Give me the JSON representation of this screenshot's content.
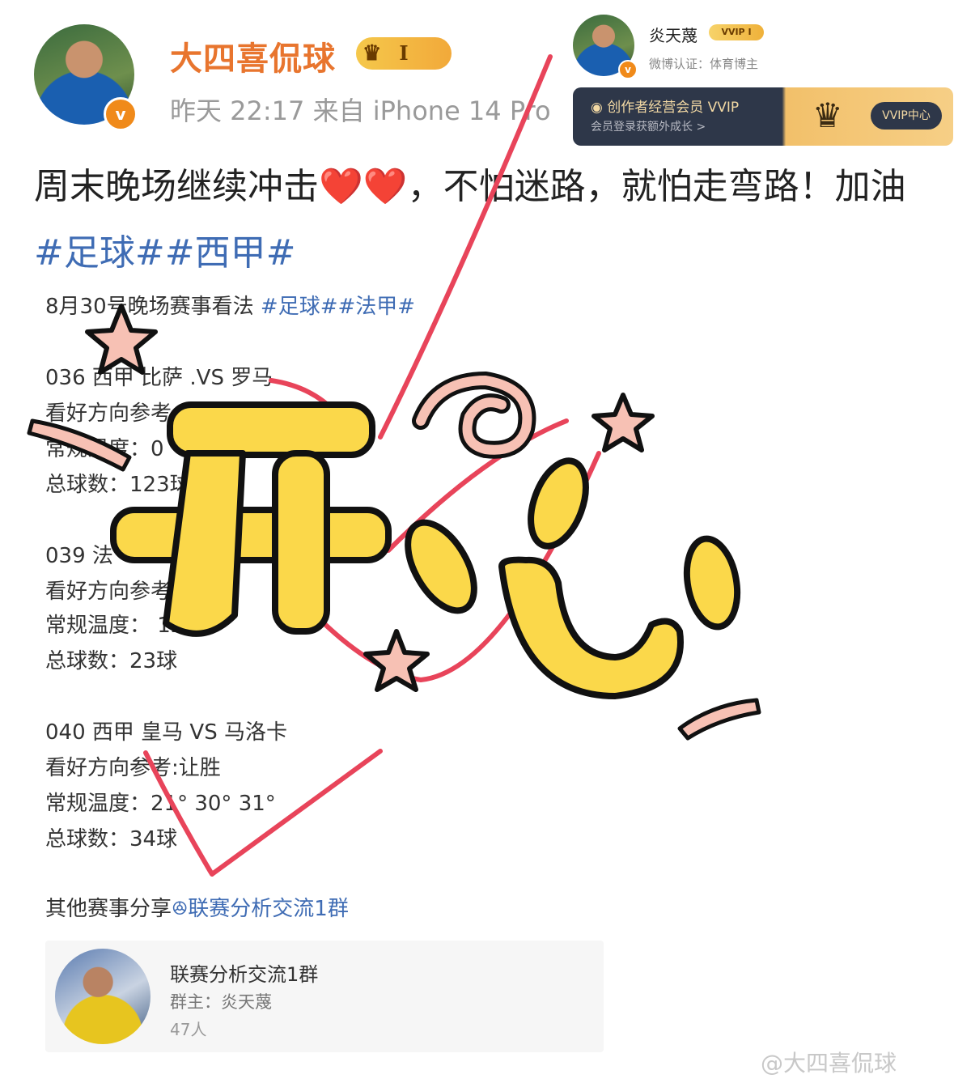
{
  "post": {
    "username": "大四喜侃球",
    "level_badge": "I",
    "meta": "昨天 22:17  来自 iPhone 14 Pro",
    "text_plain": "周末晚场继续冲击",
    "text_after_hearts": "，不怕迷路，就怕走弯路！加油",
    "hearts": "❤️❤️",
    "tag1": "#足球#",
    "tag2": "#西甲#"
  },
  "profile_card": {
    "name": "炎天蔑",
    "vip_badge": "VVIP I",
    "verification": "微博认证：体育博主",
    "banner_title": "创作者经营会员 VVIP",
    "banner_subtitle": "会员登录获额外成长 >",
    "banner_button": "VVIP中心"
  },
  "screenshot": {
    "heading": "8月30号晚场赛事看法",
    "heading_tags": "#足球##法甲#",
    "match1_title": "036 西甲 比萨 .VS 罗马",
    "match1_pick": "看好方向参考:",
    "match1_temp": "常规温度：0",
    "match1_goals": "总球数：123球",
    "match2_title": "039 法",
    "match2_pick": "看好方向参考:让负",
    "match2_temp": "常规温度：  12°",
    "match2_goals": "总球数：23球",
    "match3_title": "040 西甲 皇马 VS 马洛卡",
    "match3_pick": "看好方向参考:让胜",
    "match3_temp": "常规温度：21° 30° 31°",
    "match3_goals": "总球数：34球",
    "others_label": "其他赛事分享",
    "others_link": "联赛分析交流1群",
    "group_name": "联赛分析交流1群",
    "group_owner": "群主：炎天蔑",
    "group_count": "47人"
  },
  "sticker_text": "开心",
  "watermark": "@大四喜侃球",
  "colors": {
    "username": "#e8752e",
    "tag": "#3f6cb4",
    "checkmark": "#e8445a",
    "sticker_fill": "#fbd84a"
  }
}
